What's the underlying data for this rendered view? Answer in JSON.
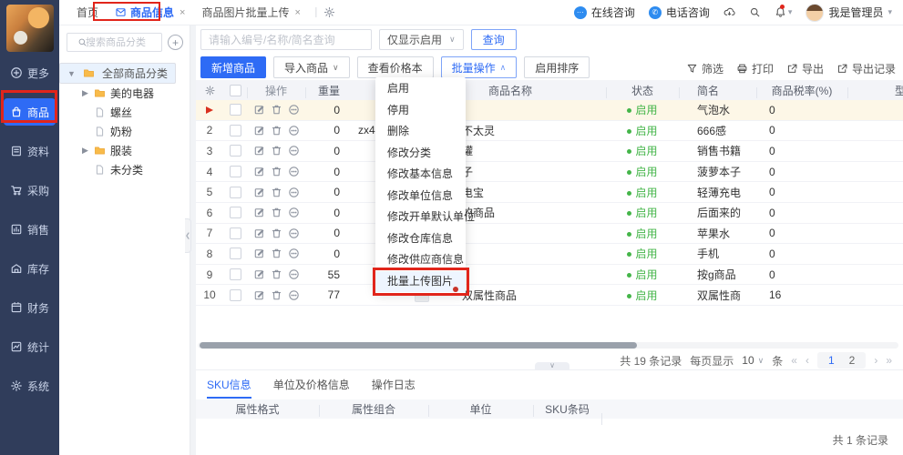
{
  "colors": {
    "primary": "#2e6bf5",
    "sidebar_bg": "#303d5b",
    "status_green": "#44b549",
    "annotation_red": "#e1251b",
    "row_highlight": "#fdf7e7",
    "folder_orange": "#f8bb4a"
  },
  "topbar": {
    "tabs": [
      {
        "key": "home",
        "label": "首页",
        "active": false,
        "closable": false
      },
      {
        "key": "product-info",
        "label": "商品信息",
        "active": true,
        "closable": true,
        "annotated": true
      },
      {
        "key": "image-batch-upload",
        "label": "商品图片批量上传",
        "active": false,
        "closable": true
      }
    ],
    "quick_links": [
      {
        "key": "online-consult",
        "label": "在线咨询"
      },
      {
        "key": "phone-consult",
        "label": "电话咨询"
      }
    ],
    "user_name": "我是管理员"
  },
  "sidebar": {
    "items": [
      {
        "key": "more",
        "label": "更多",
        "icon": "plus-circle-icon",
        "active": false
      },
      {
        "key": "goods",
        "label": "商品",
        "icon": "bag-icon",
        "active": true,
        "annotated": true
      },
      {
        "key": "data",
        "label": "资料",
        "icon": "document-icon",
        "active": false
      },
      {
        "key": "purchase",
        "label": "采购",
        "icon": "cart-icon",
        "active": false
      },
      {
        "key": "sales",
        "label": "销售",
        "icon": "bar-chart-icon",
        "active": false
      },
      {
        "key": "inventory",
        "label": "库存",
        "icon": "warehouse-icon",
        "active": false
      },
      {
        "key": "finance",
        "label": "财务",
        "icon": "calendar-icon",
        "active": false
      },
      {
        "key": "stats",
        "label": "统计",
        "icon": "line-chart-icon",
        "active": false
      },
      {
        "key": "system",
        "label": "系统",
        "icon": "gear-icon",
        "active": false
      }
    ]
  },
  "tree": {
    "search_placeholder": "搜索商品分类",
    "nodes": [
      {
        "label": "全部商品分类",
        "type": "folder",
        "caret": "down",
        "selected": true,
        "level": 0
      },
      {
        "label": "美的电器",
        "type": "folder",
        "caret": "right",
        "selected": false,
        "level": 1
      },
      {
        "label": "螺丝",
        "type": "file",
        "caret": "none",
        "selected": false,
        "level": 1
      },
      {
        "label": "奶粉",
        "type": "file",
        "caret": "none",
        "selected": false,
        "level": 1
      },
      {
        "label": "服装",
        "type": "folder",
        "caret": "right",
        "selected": false,
        "level": 1
      },
      {
        "label": "未分类",
        "type": "file",
        "caret": "none",
        "selected": false,
        "level": 1
      }
    ]
  },
  "filterbar": {
    "keyword_placeholder": "请输入编号/名称/简名查询",
    "status_filter": "仅显示启用",
    "query": "查询"
  },
  "toolbar": {
    "buttons": [
      {
        "key": "add-product",
        "label": "新增商品",
        "style": "primary",
        "caret": "none"
      },
      {
        "key": "import-product",
        "label": "导入商品",
        "style": "default",
        "caret": "down"
      },
      {
        "key": "view-price-book",
        "label": "查看价格本",
        "style": "default",
        "caret": "none"
      },
      {
        "key": "bulk-actions",
        "label": "批量操作",
        "style": "outline",
        "caret": "up"
      },
      {
        "key": "enable-sort",
        "label": "启用排序",
        "style": "default",
        "caret": "none"
      }
    ],
    "tools": [
      {
        "key": "filter",
        "label": "筛选",
        "icon": "filter-icon"
      },
      {
        "key": "print",
        "label": "打印",
        "icon": "printer-icon"
      },
      {
        "key": "export",
        "label": "导出",
        "icon": "export-icon"
      },
      {
        "key": "export-log",
        "label": "导出记录",
        "icon": "export-icon"
      }
    ]
  },
  "table": {
    "columns": [
      "操作",
      "重量",
      "商品名称",
      "状态",
      "简名",
      "商品税率(%)",
      "型"
    ],
    "rows": [
      {
        "index": "",
        "flag": true,
        "weight": "0",
        "code": "",
        "name": "",
        "status": "启用",
        "short_name": "气泡水",
        "tax": "0",
        "highlight": true
      },
      {
        "index": "2",
        "flag": false,
        "weight": "0",
        "code": "zx45",
        "name": "不太灵",
        "status": "启用",
        "short_name": "666感",
        "tax": "0",
        "highlight": false
      },
      {
        "index": "3",
        "flag": false,
        "weight": "0",
        "code": "",
        "name": "罐",
        "status": "启用",
        "short_name": "销售书籍",
        "tax": "0",
        "highlight": false
      },
      {
        "index": "4",
        "flag": false,
        "weight": "0",
        "code": "",
        "name": "子",
        "status": "启用",
        "short_name": "菠萝本子",
        "tax": "0",
        "highlight": false
      },
      {
        "index": "5",
        "flag": false,
        "weight": "0",
        "code": "",
        "name": "电宝",
        "status": "启用",
        "short_name": "轻薄充电",
        "tax": "0",
        "highlight": false
      },
      {
        "index": "6",
        "flag": false,
        "weight": "0",
        "code": "",
        "name": "的商品",
        "status": "启用",
        "short_name": "后面来的",
        "tax": "0",
        "highlight": false
      },
      {
        "index": "7",
        "flag": false,
        "weight": "0",
        "code": "",
        "name": "",
        "status": "启用",
        "short_name": "苹果水",
        "tax": "0",
        "highlight": false
      },
      {
        "index": "8",
        "flag": false,
        "weight": "0",
        "code": "",
        "name": "",
        "status": "启用",
        "short_name": "手机",
        "tax": "0",
        "highlight": false
      },
      {
        "index": "9",
        "flag": false,
        "weight": "55",
        "code": "",
        "name": "",
        "status": "启用",
        "short_name": "按g商品",
        "tax": "0",
        "highlight": false
      },
      {
        "index": "10",
        "flag": false,
        "weight": "77",
        "code": "",
        "name": "双属性商品",
        "status": "启用",
        "short_name": "双属性商",
        "tax": "16",
        "highlight": false
      }
    ]
  },
  "bulk_menu": {
    "items": [
      {
        "key": "enable",
        "label": "启用"
      },
      {
        "key": "disable",
        "label": "停用"
      },
      {
        "key": "delete",
        "label": "删除"
      },
      {
        "key": "edit-category",
        "label": "修改分类"
      },
      {
        "key": "edit-basic-info",
        "label": "修改基本信息"
      },
      {
        "key": "edit-unit-info",
        "label": "修改单位信息"
      },
      {
        "key": "edit-default-unit",
        "label": "修改开单默认单位"
      },
      {
        "key": "edit-warehouse-info",
        "label": "修改仓库信息"
      },
      {
        "key": "edit-supplier-info",
        "label": "修改供应商信息"
      },
      {
        "key": "batch-upload-images",
        "label": "批量上传图片"
      }
    ],
    "active_item": "批量上传图片"
  },
  "pagination": {
    "total_text": "共 19 条记录",
    "per_page_label": "每页显示",
    "per_page": "10",
    "unit": "条",
    "pages": [
      "1",
      "2"
    ],
    "current": "1"
  },
  "bottom_panel": {
    "tabs": [
      "SKU信息",
      "单位及价格信息",
      "操作日志"
    ],
    "active_tab": "SKU信息",
    "columns": [
      "属性格式",
      "属性组合",
      "单位",
      "SKU条码"
    ],
    "total_text": "共 1 条记录"
  }
}
